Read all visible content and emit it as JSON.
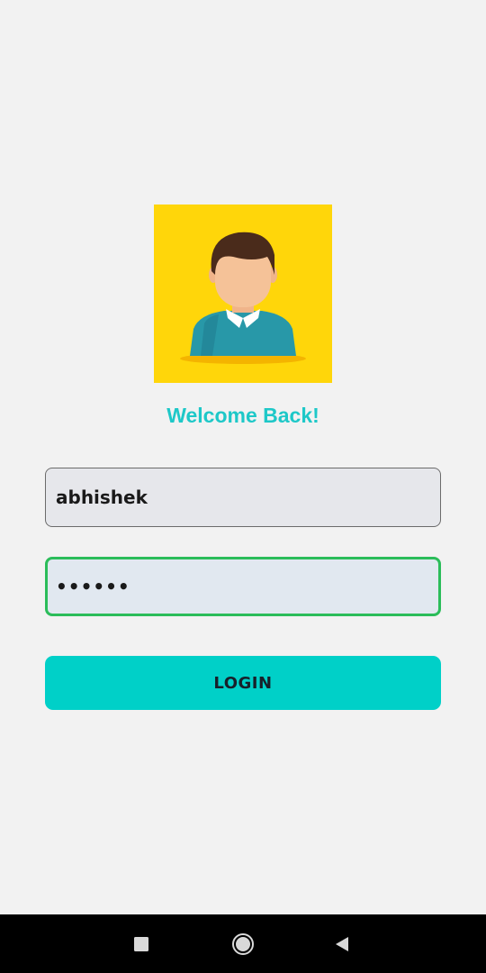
{
  "login_screen": {
    "welcome_text": "Welcome Back!",
    "username": {
      "value": "abhishek",
      "placeholder": ""
    },
    "password": {
      "value": "abhish",
      "placeholder": ""
    },
    "login_button_label": "LOGIN",
    "avatar_icon": "user-avatar-illustration"
  },
  "colors": {
    "background": "#f2f2f2",
    "accent": "#00d0c8",
    "welcome_text": "#1ec8c8",
    "avatar_background": "#ffd60a",
    "focused_border": "#2bbd5a"
  },
  "nav_bar": {
    "icons": [
      "recent-apps-icon",
      "home-icon",
      "back-icon"
    ]
  }
}
